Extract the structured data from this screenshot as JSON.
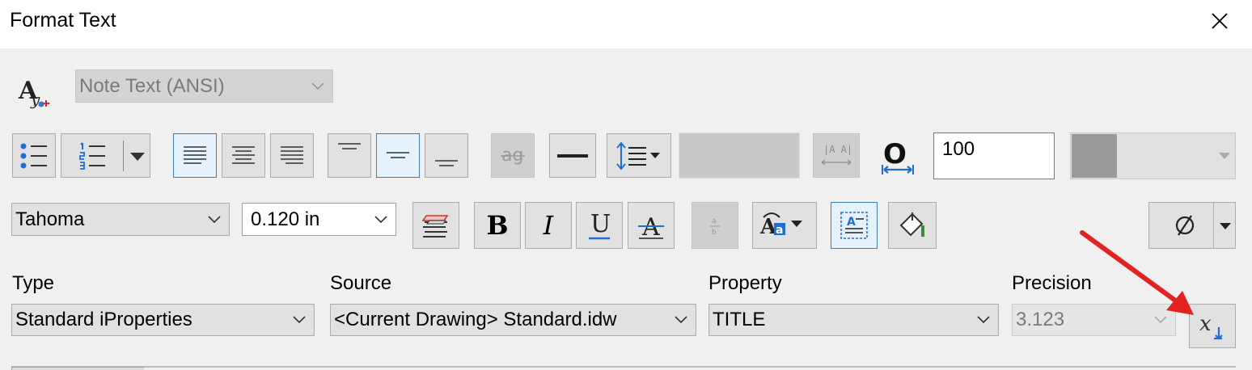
{
  "window": {
    "title": "Format Text"
  },
  "style": {
    "value": "Note Text (ANSI)"
  },
  "spacing": {
    "value": "100"
  },
  "font": {
    "name": "Tahoma",
    "size": "0.120 in"
  },
  "labels": {
    "type": "Type",
    "source": "Source",
    "property": "Property",
    "precision": "Precision"
  },
  "fields": {
    "type": "Standard iProperties",
    "source": "<Current Drawing> Standard.idw",
    "property": "TITLE",
    "precision": "3.123"
  },
  "icons": {
    "text_style": "text-style-icon",
    "bullets": "bulleted-list-icon",
    "numbering": "numbered-list-icon",
    "align_left": "align-left-icon",
    "align_center": "align-center-icon",
    "align_right": "align-right-icon",
    "valign_top": "valign-top-icon",
    "valign_middle": "valign-middle-icon",
    "valign_bottom": "valign-bottom-icon",
    "stack": "stack-text-icon",
    "rule": "horizontal-rule-icon",
    "line_spacing": "line-spacing-icon",
    "char_spacing": "character-spacing-icon",
    "width_factor": "width-factor-icon",
    "layers": "text-layers-icon",
    "bold": "bold-icon",
    "italic": "italic-icon",
    "underline": "underline-icon",
    "strike": "strikethrough-icon",
    "fraction": "stacked-fraction-icon",
    "case": "change-case-icon",
    "background": "text-background-icon",
    "fill": "fill-color-icon",
    "symbol": "diameter-symbol-icon",
    "add_parameter": "add-parameter-icon"
  },
  "colors": {
    "accent_blue": "#1f6fd1",
    "annotation_arrow": "#e32222"
  }
}
